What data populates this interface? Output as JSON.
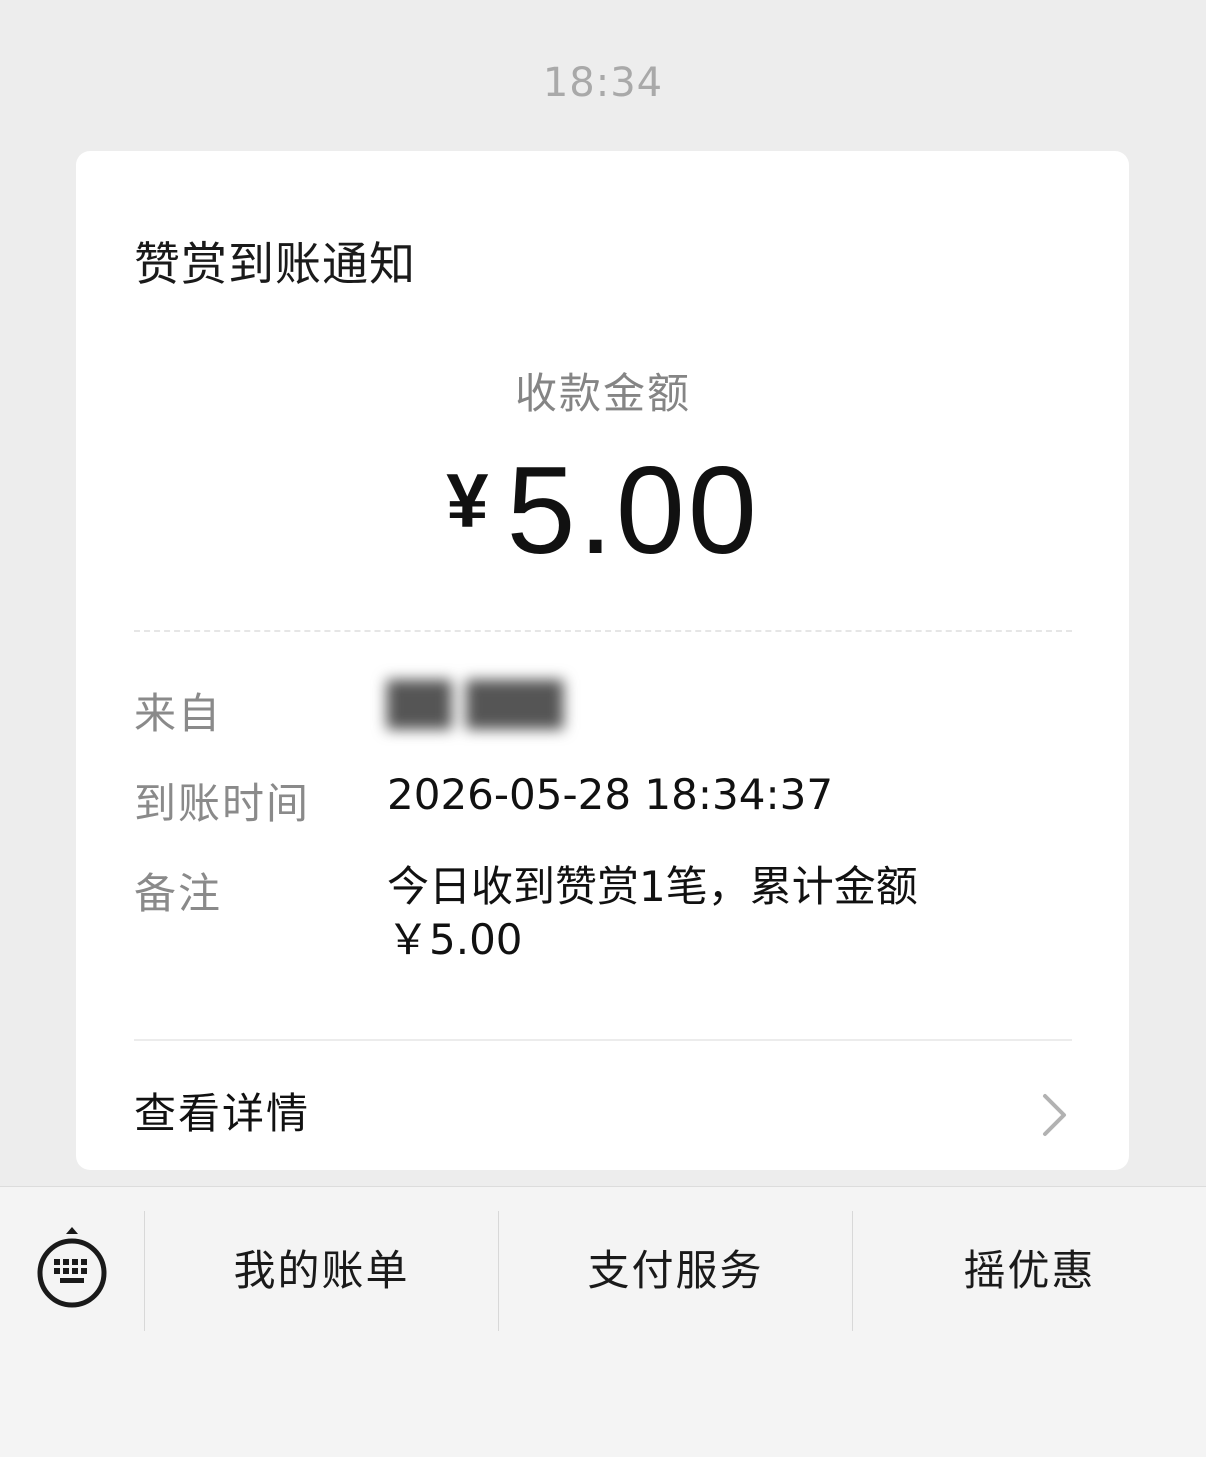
{
  "timestamp": "18:34",
  "card": {
    "title": "赞赏到账通知",
    "amount_label": "收款金额",
    "currency_symbol": "¥",
    "amount_value": "5.00",
    "rows": {
      "from_label": "来自",
      "from_value": "██ ███",
      "time_label": "到账时间",
      "time_value": "2026-05-28 18:34:37",
      "note_label": "备注",
      "note_value_line1": "今日收到赞赏1笔，累计金额",
      "note_value_line2": "￥5.00"
    },
    "details_label": "查看详情",
    "details_icon": "chevron-right-icon"
  },
  "bottom_menu": {
    "keyboard_icon": "keyboard-icon",
    "items": [
      "我的账单",
      "支付服务",
      "摇优惠"
    ]
  },
  "colors": {
    "background": "#ededed",
    "card": "#ffffff",
    "bottom_bar": "#f4f4f4",
    "muted_text": "#8a8a8a",
    "primary_text": "#111111"
  }
}
